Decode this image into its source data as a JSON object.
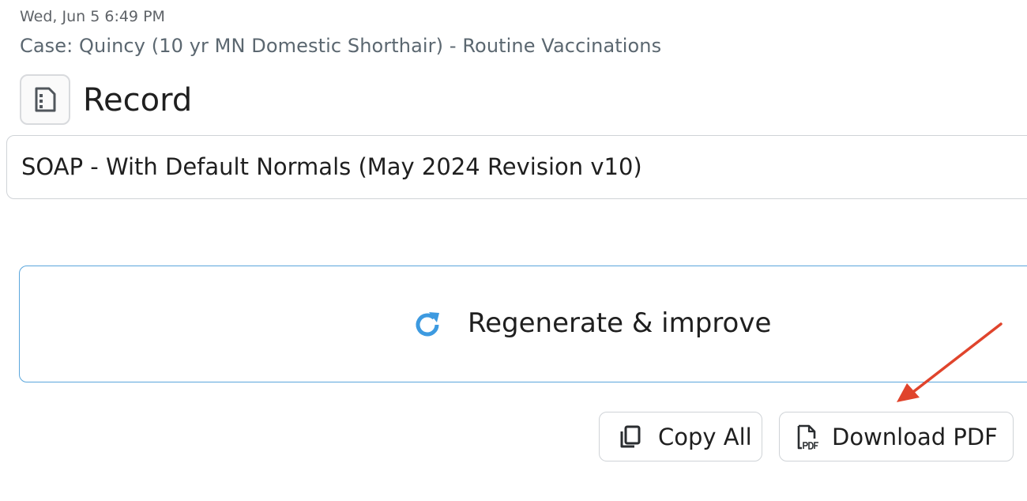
{
  "header": {
    "timestamp": "Wed, Jun 5 6:49 PM",
    "case": "Case: Quincy (10 yr MN Domestic Shorthair) - Routine Vaccinations"
  },
  "record": {
    "icon": "document-icon",
    "title": "Record"
  },
  "template_select": {
    "value": "SOAP - With Default Normals (May 2024 Revision v10)"
  },
  "regenerate": {
    "icon": "refresh-icon",
    "label": "Regenerate & improve",
    "accent_color": "#3d9ae0"
  },
  "actions": {
    "copy": {
      "icon": "copy-icon",
      "label": "Copy All"
    },
    "download": {
      "icon": "pdf-file-icon",
      "label": "Download PDF"
    }
  },
  "annotation": {
    "icon": "red-arrow",
    "color": "#e0442c"
  }
}
